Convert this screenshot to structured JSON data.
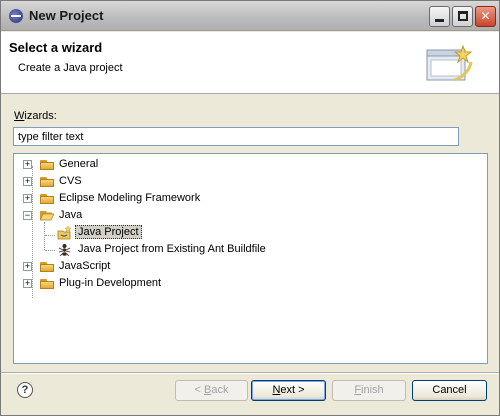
{
  "window": {
    "title": "New Project"
  },
  "header": {
    "title": "Select a wizard",
    "description": "Create a Java project"
  },
  "wizards": {
    "label_first": "W",
    "label_rest": "izards:",
    "filter_value": "type filter text"
  },
  "tree": {
    "items": [
      {
        "label": "General",
        "expander": "+",
        "icon": "folder-icon"
      },
      {
        "label": "CVS",
        "expander": "+",
        "icon": "folder-icon"
      },
      {
        "label": "Eclipse Modeling Framework",
        "expander": "+",
        "icon": "folder-icon"
      },
      {
        "label": "Java",
        "expander": "−",
        "icon": "folder-open-icon"
      },
      {
        "label": "Java Project",
        "icon": "java-project-wizard-icon",
        "selected": true
      },
      {
        "label": "Java Project from Existing Ant Buildfile",
        "icon": "ant-icon"
      },
      {
        "label": "JavaScript",
        "expander": "+",
        "icon": "folder-icon"
      },
      {
        "label": "Plug-in Development",
        "expander": "+",
        "icon": "folder-icon"
      }
    ]
  },
  "footer": {
    "help_glyph": "?",
    "back_prefix": "< ",
    "back_u": "B",
    "back_rest": "ack",
    "next_u": "N",
    "next_rest": "ext >",
    "finish_u": "F",
    "finish_rest": "inish",
    "cancel_label": "Cancel"
  }
}
